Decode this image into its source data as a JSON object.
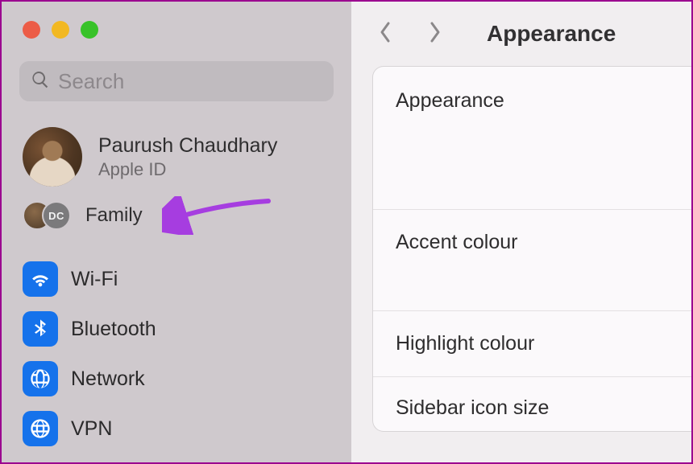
{
  "search": {
    "placeholder": "Search"
  },
  "account": {
    "name": "Paurush Chaudhary",
    "sub": "Apple ID"
  },
  "family": {
    "label": "Family",
    "second_avatar_initials": "DC"
  },
  "sidebar": {
    "items": [
      {
        "label": "Wi-Fi"
      },
      {
        "label": "Bluetooth"
      },
      {
        "label": "Network"
      },
      {
        "label": "VPN"
      }
    ]
  },
  "header": {
    "title": "Appearance"
  },
  "panel": {
    "rows": [
      "Appearance",
      "Accent colour",
      "Highlight colour",
      "Sidebar icon size"
    ]
  },
  "colors": {
    "accent_blue": "#1572eb",
    "annotation": "#a63de0"
  }
}
